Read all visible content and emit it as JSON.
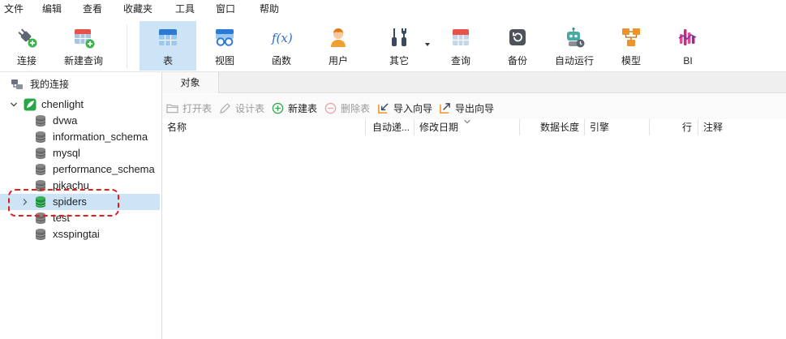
{
  "menu": {
    "items": [
      "文件",
      "编辑",
      "查看",
      "收藏夹",
      "工具",
      "窗口",
      "帮助"
    ]
  },
  "toolbar": {
    "items": [
      {
        "label": "连接",
        "icon": "plug-icon"
      },
      {
        "label": "新建查询",
        "icon": "new-query-icon"
      },
      {
        "label": "表",
        "icon": "table-icon",
        "active": true
      },
      {
        "label": "视图",
        "icon": "view-icon"
      },
      {
        "label": "函数",
        "icon": "function-icon",
        "glyph": "f(x)"
      },
      {
        "label": "用户",
        "icon": "user-icon"
      },
      {
        "label": "其它",
        "icon": "tools-icon",
        "has_dropdown": true
      },
      {
        "label": "查询",
        "icon": "query-icon"
      },
      {
        "label": "备份",
        "icon": "backup-icon"
      },
      {
        "label": "自动运行",
        "icon": "robot-icon"
      },
      {
        "label": "模型",
        "icon": "model-icon"
      },
      {
        "label": "BI",
        "icon": "bi-icon"
      }
    ]
  },
  "sidebar": {
    "root": {
      "label": "我的连接",
      "icon": "connections-icon"
    },
    "connection": {
      "name": "chenlight",
      "icon": "mysql-connection-icon",
      "expanded": true
    },
    "databases": [
      {
        "name": "dvwa"
      },
      {
        "name": "information_schema"
      },
      {
        "name": "mysql"
      },
      {
        "name": "performance_schema"
      },
      {
        "name": "pikachu"
      },
      {
        "name": "spiders",
        "selected": true,
        "expandable": true
      },
      {
        "name": "test"
      },
      {
        "name": "xsspingtai"
      }
    ]
  },
  "tabs": [
    {
      "label": "对象",
      "active": true
    }
  ],
  "object_toolbar": {
    "actions": [
      {
        "label": "打开表",
        "icon": "folder-icon",
        "enabled": false
      },
      {
        "label": "设计表",
        "icon": "pencil-icon",
        "enabled": false
      },
      {
        "label": "新建表",
        "icon": "add-circle-icon",
        "enabled": true
      },
      {
        "label": "删除表",
        "icon": "remove-circle-icon",
        "enabled": false
      },
      {
        "label": "导入向导",
        "icon": "import-icon",
        "enabled": true
      },
      {
        "label": "导出向导",
        "icon": "export-icon",
        "enabled": true
      }
    ]
  },
  "object_table": {
    "columns": [
      {
        "label": "名称"
      },
      {
        "label": "自动递..."
      },
      {
        "label": "修改日期",
        "sorted": true
      },
      {
        "label": "数据长度"
      },
      {
        "label": "引擎"
      },
      {
        "label": "行"
      },
      {
        "label": "注释"
      }
    ],
    "rows": []
  },
  "colors": {
    "selection": "#cde4f7",
    "annotation": "#e01e1e",
    "connection_green": "#29a745",
    "disabled_text": "#9a9a9a"
  }
}
